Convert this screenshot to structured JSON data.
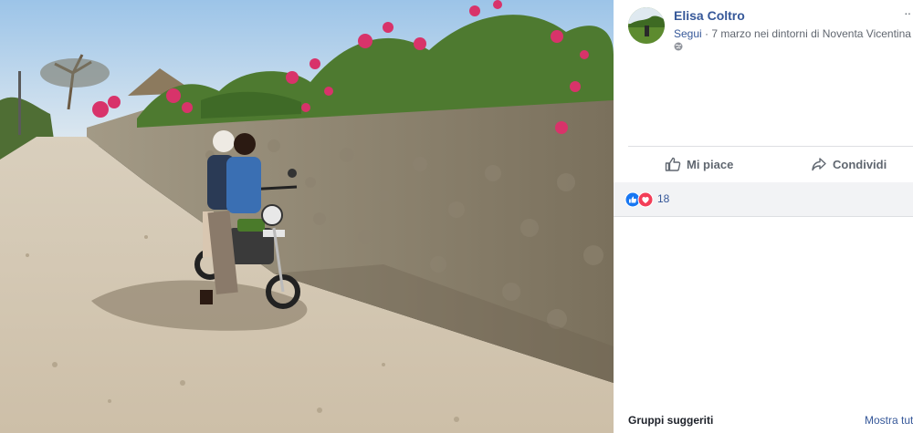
{
  "post": {
    "author": "Elisa Coltro",
    "follow_label": "Segui",
    "meta_text": " · 7 marzo nei dintorni di Noventa Vicentina ·",
    "more_label": "··"
  },
  "actions": {
    "like_label": "Mi piace",
    "share_label": "Condividi"
  },
  "reactions": {
    "types": [
      "like-icon",
      "love-icon"
    ],
    "count": "18"
  },
  "suggestions": {
    "title": "Gruppi suggeriti",
    "show_all": "Mostra tut"
  },
  "colors": {
    "link": "#365899",
    "like_blue": "#1877f2",
    "love_red": "#f33e58"
  }
}
